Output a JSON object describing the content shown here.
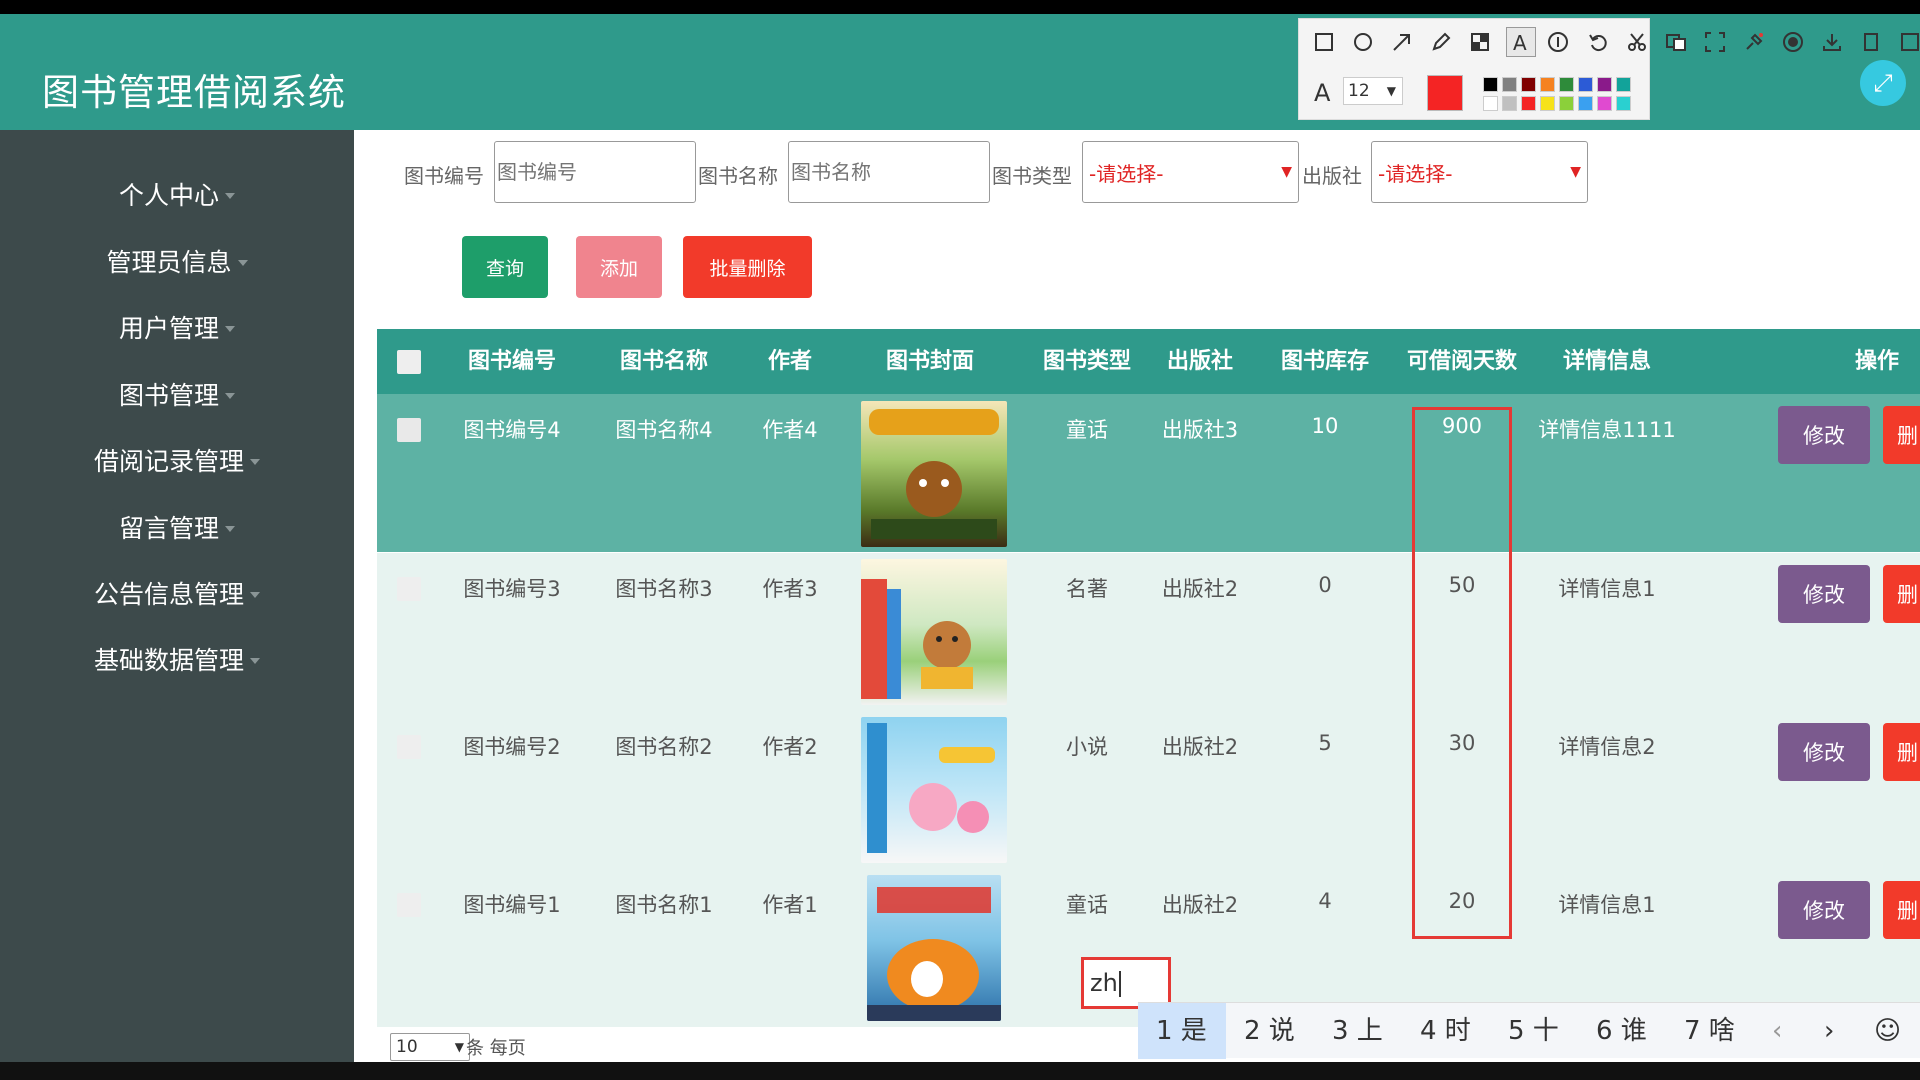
{
  "app": {
    "title": "图书管理借阅系统"
  },
  "sidebar": {
    "items": [
      {
        "label": "个人中心"
      },
      {
        "label": "管理员信息"
      },
      {
        "label": "用户管理"
      },
      {
        "label": "图书管理"
      },
      {
        "label": "借阅记录管理"
      },
      {
        "label": "留言管理"
      },
      {
        "label": "公告信息管理"
      },
      {
        "label": "基础数据管理"
      }
    ]
  },
  "filters": {
    "book_no_label": "图书编号",
    "book_no_placeholder": "图书编号",
    "book_name_label": "图书名称",
    "book_name_placeholder": "图书名称",
    "book_type_label": "图书类型",
    "book_type_value": "-请选择-",
    "publisher_label": "出版社",
    "publisher_value": "-请选择-"
  },
  "actions": {
    "query": "查询",
    "add": "添加",
    "batch_delete": "批量删除"
  },
  "table": {
    "headers": [
      "图书编号",
      "图书名称",
      "作者",
      "图书封面",
      "图书类型",
      "出版社",
      "图书库存",
      "可借阅天数",
      "详情信息",
      "操作"
    ],
    "rows": [
      {
        "no": "图书编号4",
        "name": "图书名称4",
        "author": "作者4",
        "type": "童话",
        "publisher": "出版社3",
        "stock": "10",
        "days": "900",
        "detail": "详情信息1111",
        "edit": "修改",
        "del": "删"
      },
      {
        "no": "图书编号3",
        "name": "图书名称3",
        "author": "作者3",
        "type": "名著",
        "publisher": "出版社2",
        "stock": "0",
        "days": "50",
        "detail": "详情信息1",
        "edit": "修改",
        "del": "删"
      },
      {
        "no": "图书编号2",
        "name": "图书名称2",
        "author": "作者2",
        "type": "小说",
        "publisher": "出版社2",
        "stock": "5",
        "days": "30",
        "detail": "详情信息2",
        "edit": "修改",
        "del": "删"
      },
      {
        "no": "图书编号1",
        "name": "图书名称1",
        "author": "作者1",
        "type": "童话",
        "publisher": "出版社2",
        "stock": "4",
        "days": "20",
        "detail": "详情信息1",
        "edit": "修改",
        "del": "删"
      }
    ]
  },
  "pagination": {
    "page_size": "10",
    "per_page_label": "条 每页"
  },
  "ime": {
    "input": "zh",
    "candidates": [
      "1 是",
      "2 说",
      "3 上",
      "4 时",
      "5 十",
      "6 谁",
      "7 啥"
    ]
  },
  "annot_toolbar": {
    "font_size": "12"
  },
  "colors": {
    "header": "#2f9a8b",
    "sidebar": "#3d4a4b",
    "query": "#1e9e6a",
    "add": "#f0848e",
    "batch_delete": "#f23a2a",
    "edit": "#7b5a8e",
    "selected_row": "#5db2a4",
    "row": "#e7f3f0",
    "highlight": "#e53935"
  }
}
